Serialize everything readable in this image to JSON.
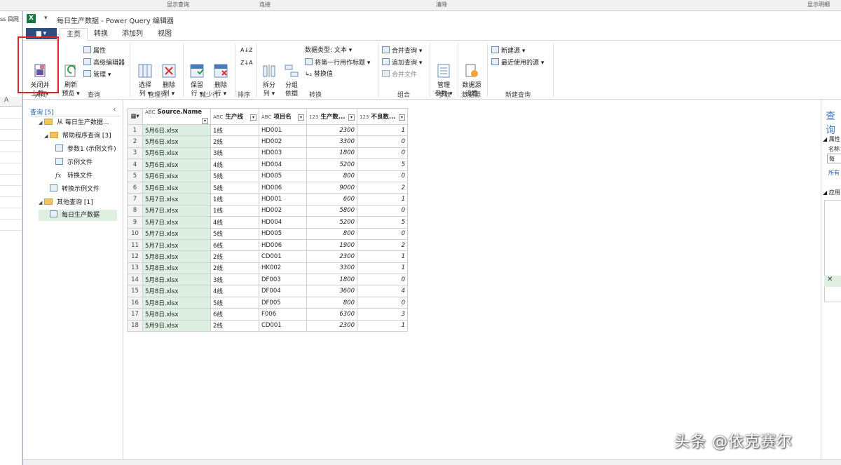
{
  "excel_bg": {
    "top_items": [
      "显示查询",
      "连接",
      "清除",
      "显示明细"
    ],
    "left_text": "ss 目网",
    "column_header": "A"
  },
  "window": {
    "title": "每日生产数据 - Power Query 编辑器",
    "quick_access": "▾"
  },
  "tabs": [
    "主页",
    "转换",
    "添加列",
    "视图"
  ],
  "ribbon": {
    "close_load": "关闭并\n上载",
    "refresh": "刷新\n预览",
    "properties": "属性",
    "advanced_editor": "高级编辑器",
    "manage": "管理",
    "choose_cols": "选择\n列",
    "remove_cols": "删除\n列",
    "keep_rows": "保留\n行",
    "remove_rows": "删除\n行",
    "split_col": "拆分\n列",
    "group_by": "分组\n依据",
    "data_type": "数据类型: 文本",
    "first_row_header": "将第一行用作标题",
    "replace_values": "替换值",
    "merge_queries": "合并查询",
    "append_queries": "追加查询",
    "combine_files": "合并文件",
    "manage_params": "管理\n参数",
    "data_source_settings": "数据源\n设置",
    "new_source": "新建源",
    "recent_sources": "最近使用的源",
    "groups": {
      "close": "关闭",
      "query": "查询",
      "manage_cols": "管理列",
      "reduce_rows": "减少行",
      "sort": "排序",
      "transform": "转换",
      "combine": "组合",
      "params": "参数",
      "data_source": "数据源",
      "new_query": "新建查询"
    }
  },
  "queries_pane": {
    "header": "查询 [5]",
    "items": [
      "从 每日生产数据...",
      "帮助程序查询 [3]",
      "参数1 (示例文件)",
      "示例文件",
      "转换文件",
      "转换示例文件",
      "其他查询 [1]",
      "每日生产数据"
    ]
  },
  "grid": {
    "columns": [
      {
        "type": "ABC",
        "name": "Source.Name"
      },
      {
        "type": "ABC",
        "name": "生产线"
      },
      {
        "type": "ABC",
        "name": "项目名"
      },
      {
        "type": "123",
        "name": "生产数..."
      },
      {
        "type": "123",
        "name": "不良数..."
      }
    ],
    "rows": [
      [
        "5月6日.xlsx",
        "1线",
        "HD001",
        "2300",
        "1"
      ],
      [
        "5月6日.xlsx",
        "2线",
        "HD002",
        "3300",
        "0"
      ],
      [
        "5月6日.xlsx",
        "3线",
        "HD003",
        "1800",
        "0"
      ],
      [
        "5月6日.xlsx",
        "4线",
        "HD004",
        "5200",
        "5"
      ],
      [
        "5月6日.xlsx",
        "5线",
        "HD005",
        "800",
        "0"
      ],
      [
        "5月6日.xlsx",
        "5线",
        "HD006",
        "9000",
        "2"
      ],
      [
        "5月7日.xlsx",
        "1线",
        "HD001",
        "600",
        "1"
      ],
      [
        "5月7日.xlsx",
        "1线",
        "HD002",
        "5800",
        "0"
      ],
      [
        "5月7日.xlsx",
        "4线",
        "HD004",
        "5200",
        "5"
      ],
      [
        "5月7日.xlsx",
        "5线",
        "HD005",
        "800",
        "0"
      ],
      [
        "5月7日.xlsx",
        "6线",
        "HD006",
        "1900",
        "2"
      ],
      [
        "5月8日.xlsx",
        "2线",
        "CD001",
        "2300",
        "1"
      ],
      [
        "5月8日.xlsx",
        "2线",
        "HK002",
        "3300",
        "1"
      ],
      [
        "5月8日.xlsx",
        "3线",
        "DF003",
        "1800",
        "0"
      ],
      [
        "5月8日.xlsx",
        "4线",
        "DF004",
        "3600",
        "4"
      ],
      [
        "5月8日.xlsx",
        "5线",
        "DF005",
        "800",
        "0"
      ],
      [
        "5月8日.xlsx",
        "6线",
        "F006",
        "6300",
        "3"
      ],
      [
        "5月9日.xlsx",
        "2线",
        "CD001",
        "2300",
        "1"
      ]
    ]
  },
  "settings_pane": {
    "title": "查询",
    "props": "属性",
    "name_label": "名称",
    "name_value": "每",
    "all_props": "所有",
    "applied_steps": "应用"
  },
  "watermark": "头条 @依克赛尔",
  "colors": {
    "accent_blue": "#2b4f80",
    "source_col": "#dcefe2",
    "highlight": "#e02020"
  }
}
